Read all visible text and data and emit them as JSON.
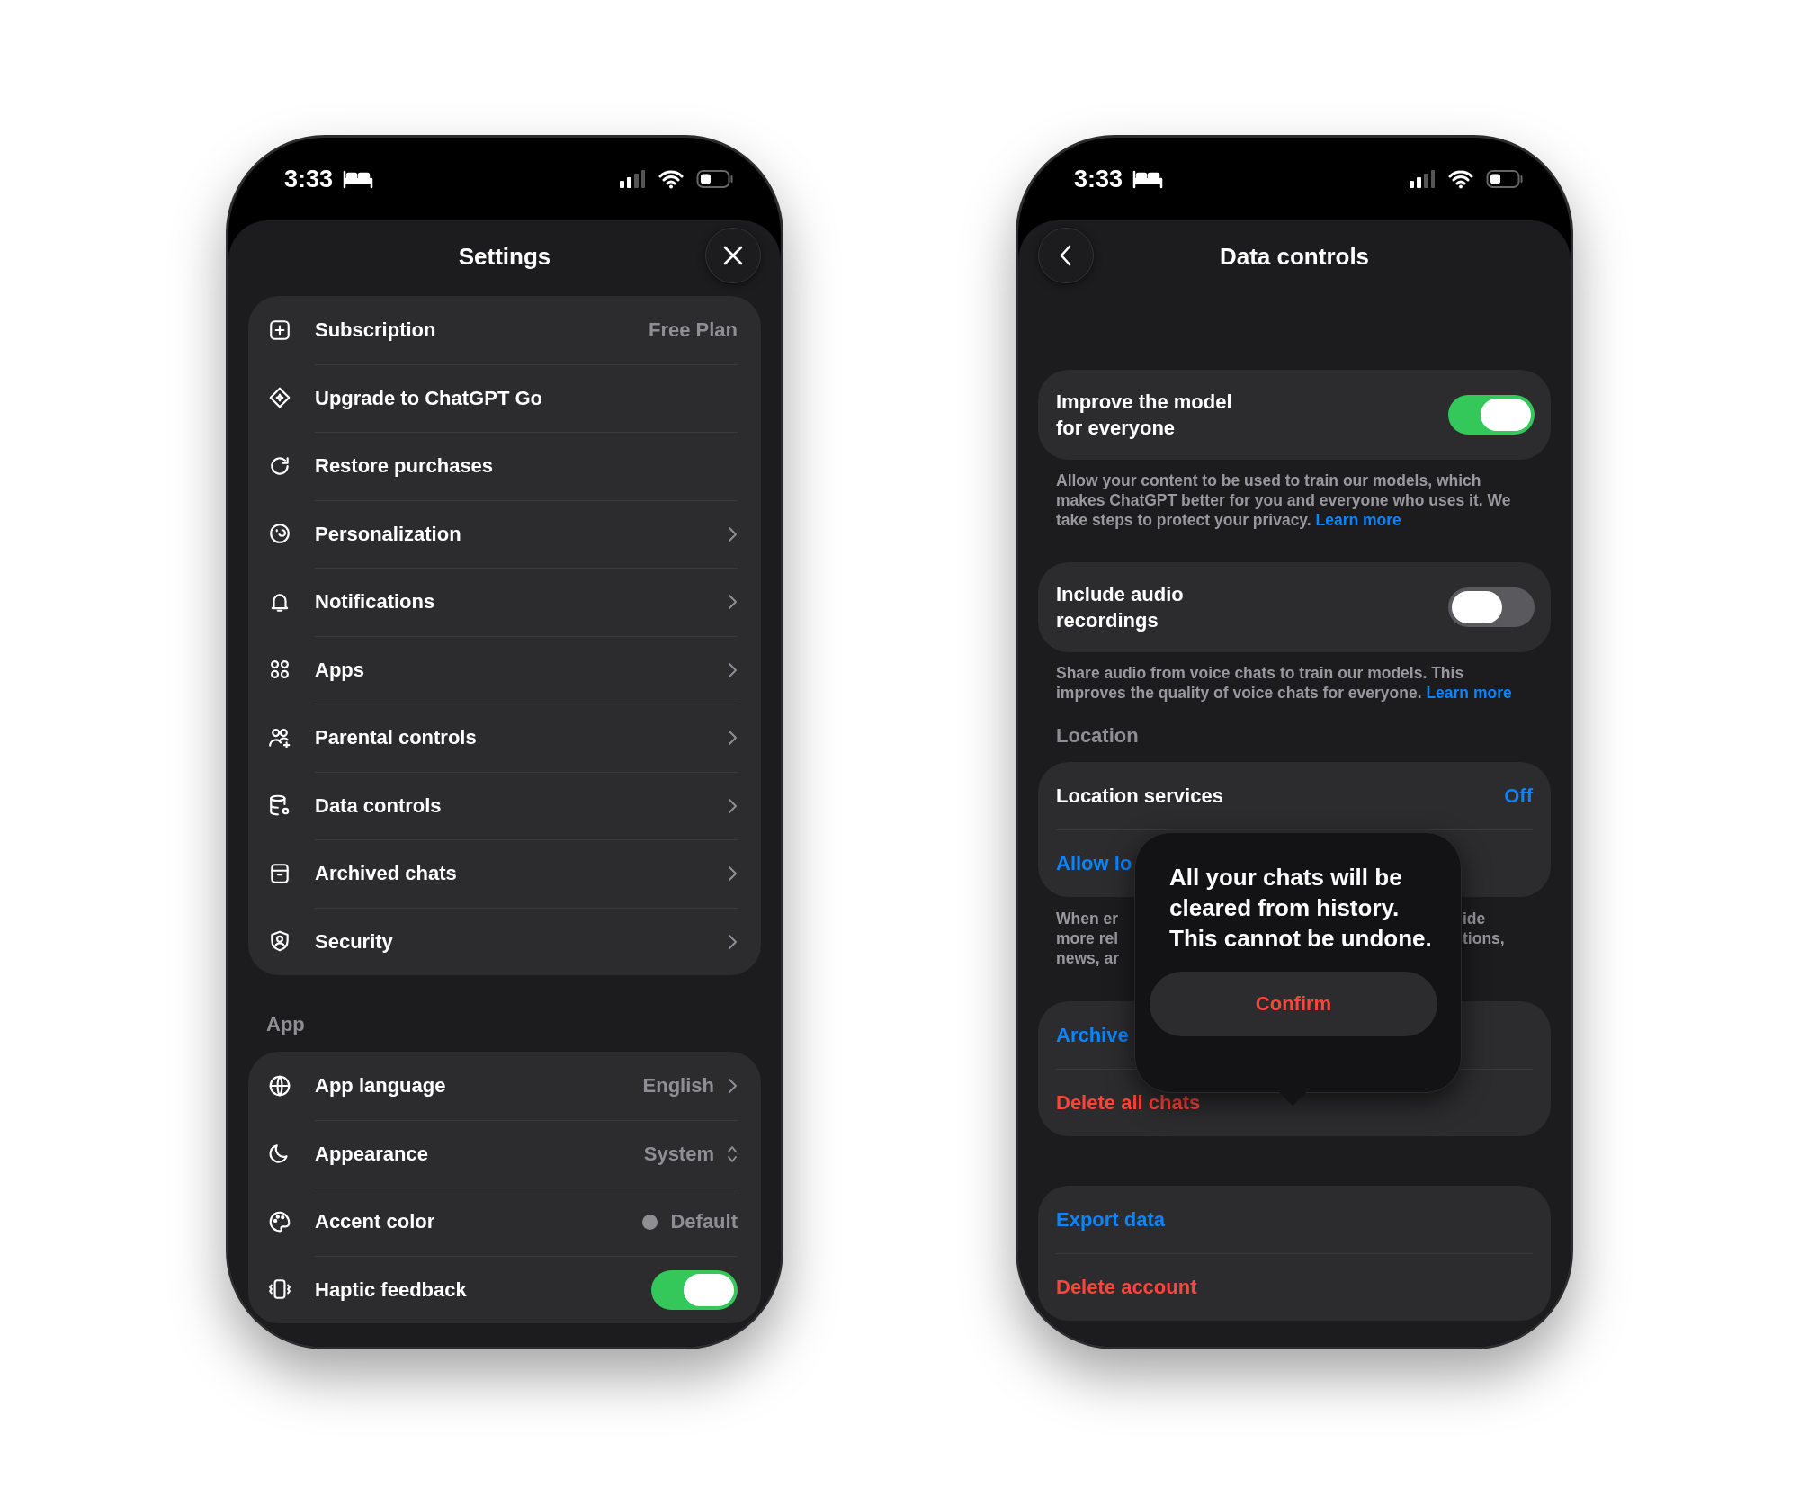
{
  "settings_screen": {
    "status_bar": {
      "time": "3:33"
    },
    "title": "Settings",
    "sections": [
      {
        "items": [
          {
            "kind": "value",
            "label": "Subscription",
            "value": "Free Plan"
          },
          {
            "kind": "action",
            "label": "Upgrade to ChatGPT Go"
          },
          {
            "kind": "action",
            "label": "Restore purchases"
          },
          {
            "kind": "link",
            "label": "Personalization"
          },
          {
            "kind": "link",
            "label": "Notifications"
          },
          {
            "kind": "link",
            "label": "Apps"
          },
          {
            "kind": "link",
            "label": "Parental controls"
          },
          {
            "kind": "link",
            "label": "Data controls"
          },
          {
            "kind": "link",
            "label": "Archived chats"
          },
          {
            "kind": "link",
            "label": "Security"
          }
        ]
      },
      {
        "heading": "App",
        "items": [
          {
            "kind": "value_link",
            "label": "App language",
            "value": "English"
          },
          {
            "kind": "select",
            "label": "Appearance",
            "value": "System"
          },
          {
            "kind": "swatch",
            "label": "Accent color",
            "value": "Default"
          },
          {
            "kind": "toggle",
            "label": "Haptic feedback",
            "on": true
          }
        ]
      }
    ]
  },
  "data_controls_screen": {
    "status_bar": {
      "time": "3:33"
    },
    "title": "Data controls",
    "toggles": [
      {
        "label": "Improve the model\nfor everyone",
        "on": true,
        "description": "Allow your content to be used to train our models, which makes ChatGPT better for you and everyone who uses it. We take steps to protect your privacy.",
        "link": "Learn more"
      },
      {
        "label": "Include audio\nrecordings",
        "on": false,
        "description": "Share audio from voice chats to train our models. This improves the quality of voice chats for everyone.",
        "link": "Learn more"
      }
    ],
    "location": {
      "heading": "Location",
      "rows": [
        {
          "kind": "value",
          "label": "Location services",
          "value": "Off"
        },
        {
          "kind": "action",
          "label": "Allow lo"
        }
      ],
      "description_left": [
        "When er",
        "more rel",
        "news, ar"
      ],
      "description_right": [
        "ide",
        "tions,"
      ]
    },
    "groups": [
      {
        "rows": [
          {
            "kind": "action",
            "label": "Archive"
          },
          {
            "kind": "destructive",
            "label": "Delete all chats"
          }
        ]
      },
      {
        "rows": [
          {
            "kind": "action",
            "label": "Export data"
          },
          {
            "kind": "destructive",
            "label": "Delete account"
          }
        ]
      }
    ],
    "popover": {
      "message": "All your chats will be cleared from history. This cannot be undone.",
      "button": "Confirm"
    }
  }
}
